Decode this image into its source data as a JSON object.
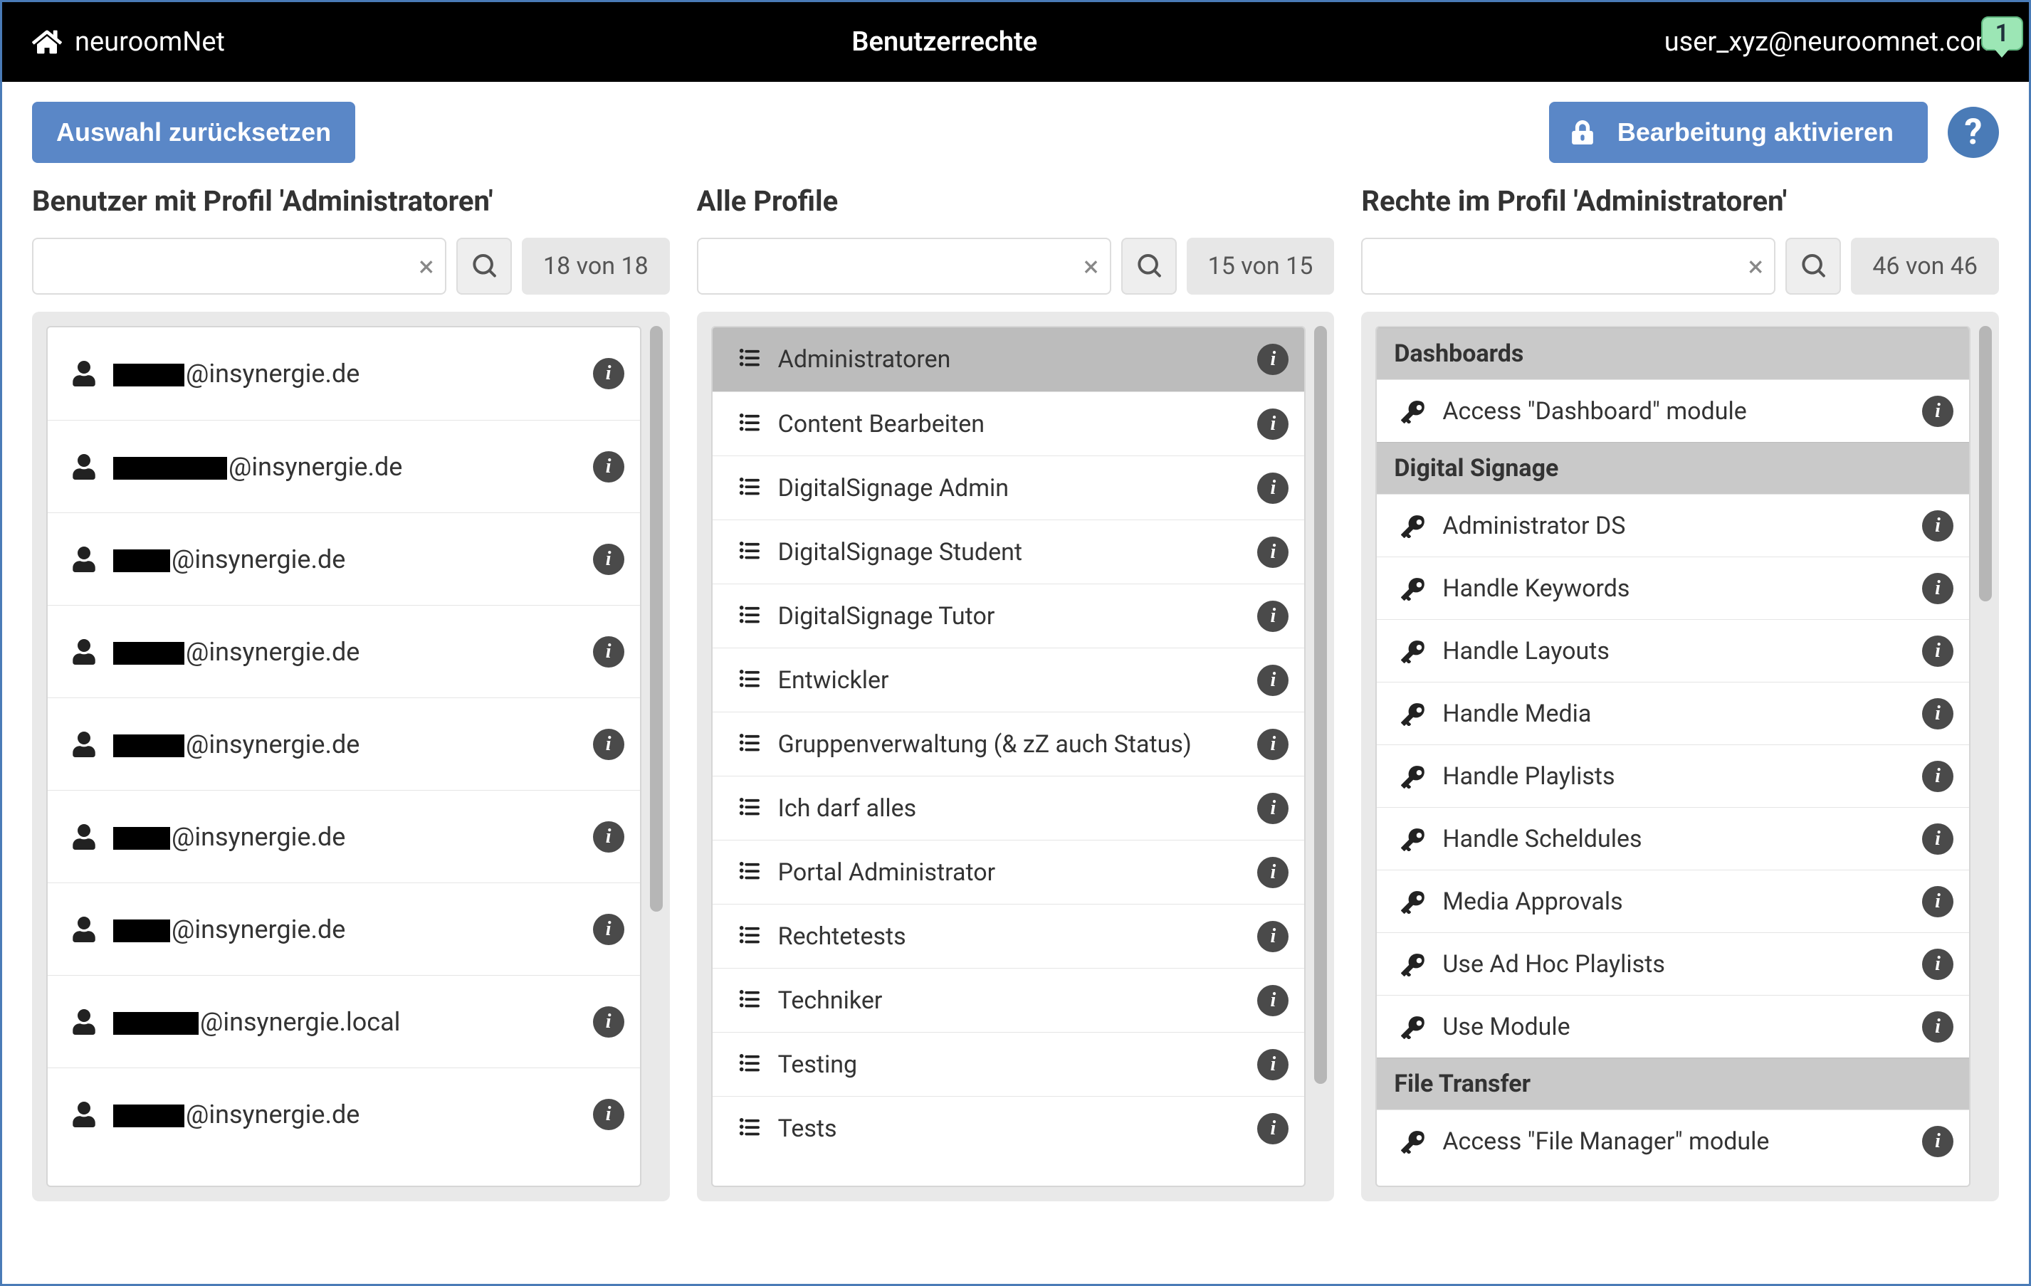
{
  "topbar": {
    "brand": "neuroomNet",
    "title": "Benutzerrechte",
    "user": "user_xyz@neuroomnet.com",
    "marker": "1"
  },
  "toolbar": {
    "reset_label": "Auswahl zurücksetzen",
    "edit_label": "Bearbeitung aktivieren"
  },
  "columns": {
    "users": {
      "heading": "Benutzer mit Profil 'Administratoren'",
      "count": "18 von 18",
      "items": [
        {
          "redact_w": 100,
          "domain": "@insynergie.de"
        },
        {
          "redact_w": 160,
          "domain": "@insynergie.de"
        },
        {
          "redact_w": 80,
          "domain": "@insynergie.de"
        },
        {
          "redact_w": 100,
          "domain": "@insynergie.de"
        },
        {
          "redact_w": 100,
          "domain": "@insynergie.de"
        },
        {
          "redact_w": 80,
          "domain": "@insynergie.de"
        },
        {
          "redact_w": 80,
          "domain": "@insynergie.de"
        },
        {
          "redact_w": 120,
          "domain": "@insynergie.local"
        },
        {
          "redact_w": 100,
          "domain": "@insynergie.de"
        }
      ]
    },
    "profiles": {
      "heading": "Alle Profile",
      "count": "15 von 15",
      "selected_index": 0,
      "items": [
        "Administratoren",
        "Content Bearbeiten",
        "DigitalSignage Admin",
        "DigitalSignage Student",
        "DigitalSignage Tutor",
        "Entwickler",
        "Gruppenverwaltung (& zZ auch Status)",
        "Ich darf alles",
        "Portal Administrator",
        "Rechtetests",
        "Techniker",
        "Testing",
        "Tests"
      ]
    },
    "rights": {
      "heading": "Rechte im Profil 'Administratoren'",
      "count": "46 von 46",
      "groups": [
        {
          "title": "Dashboards",
          "items": [
            "Access \"Dashboard\" module"
          ]
        },
        {
          "title": "Digital Signage",
          "items": [
            "Administrator DS",
            "Handle Keywords",
            "Handle Layouts",
            "Handle Media",
            "Handle Playlists",
            "Handle Scheldules",
            "Media Approvals",
            "Use Ad Hoc Playlists",
            "Use Module"
          ]
        },
        {
          "title": "File Transfer",
          "items": [
            "Access \"File Manager\" module"
          ]
        }
      ]
    }
  }
}
